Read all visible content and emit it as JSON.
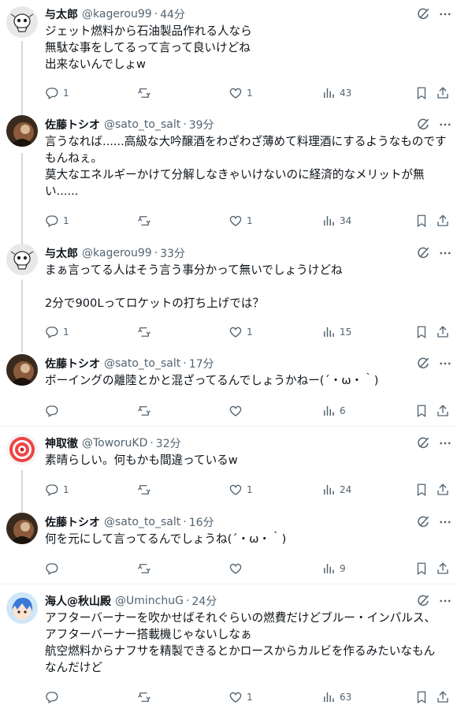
{
  "posts": [
    {
      "name": "与太郎",
      "handle": "@kagerou99",
      "time": "44分",
      "lines": [
        "ジェット燃料から石油製品作れる人なら",
        "無駄な事をしてるって言って良いけどね",
        "出来ないんでしょw"
      ],
      "replies": "1",
      "reposts": "",
      "likes": "1",
      "views": "43",
      "avatar": "skull-avatar"
    },
    {
      "name": "佐藤トシオ",
      "handle": "@sato_to_salt",
      "time": "39分",
      "lines": [
        "言うなれば......高級な大吟醸酒をわざわざ薄めて料理酒にするようなものです",
        "もんねぇ。",
        "莫大なエネルギーかけて分解しなきゃいけないのに経済的なメリットが無",
        "い......"
      ],
      "replies": "1",
      "reposts": "",
      "likes": "1",
      "views": "34",
      "avatar": "dark-avatar"
    },
    {
      "name": "与太郎",
      "handle": "@kagerou99",
      "time": "33分",
      "lines": [
        "まぁ言ってる人はそう言う事分かって無いでしょうけどね",
        "",
        "2分で900Lってロケットの打ち上げでは？"
      ],
      "replies": "1",
      "reposts": "",
      "likes": "1",
      "views": "15",
      "avatar": "skull-avatar"
    },
    {
      "name": "佐藤トシオ",
      "handle": "@sato_to_salt",
      "time": "17分",
      "lines": [
        "ボーイングの離陸とかと混ざってるんでしょうかねー(´・ω・｀)"
      ],
      "replies": "",
      "reposts": "",
      "likes": "",
      "views": "6",
      "avatar": "dark-avatar"
    },
    {
      "name": "神取徹",
      "handle": "@ToworuKD",
      "time": "32分",
      "lines": [
        "素晴らしい。何もかも間違っているw"
      ],
      "replies": "1",
      "reposts": "",
      "likes": "1",
      "views": "24",
      "avatar": "spiral-avatar"
    },
    {
      "name": "佐藤トシオ",
      "handle": "@sato_to_salt",
      "time": "16分",
      "lines": [
        "何を元にして言ってるんでしょうね(´・ω・｀)"
      ],
      "replies": "",
      "reposts": "",
      "likes": "",
      "views": "9",
      "avatar": "dark-avatar"
    },
    {
      "name": "海人@秋山殿",
      "handle": "@UminchuG",
      "time": "24分",
      "lines": [
        "アフターバーナーを吹かせばそれぐらいの燃費だけどブルー・インパルス、",
        "アフターバーナー搭載機じゃないしなぁ",
        "航空燃料からナフサを精製できるとかロースからカルビを作るみたいなもん",
        "なんだけど"
      ],
      "replies": "",
      "reposts": "",
      "likes": "1",
      "views": "63",
      "avatar": "anime-avatar"
    }
  ]
}
